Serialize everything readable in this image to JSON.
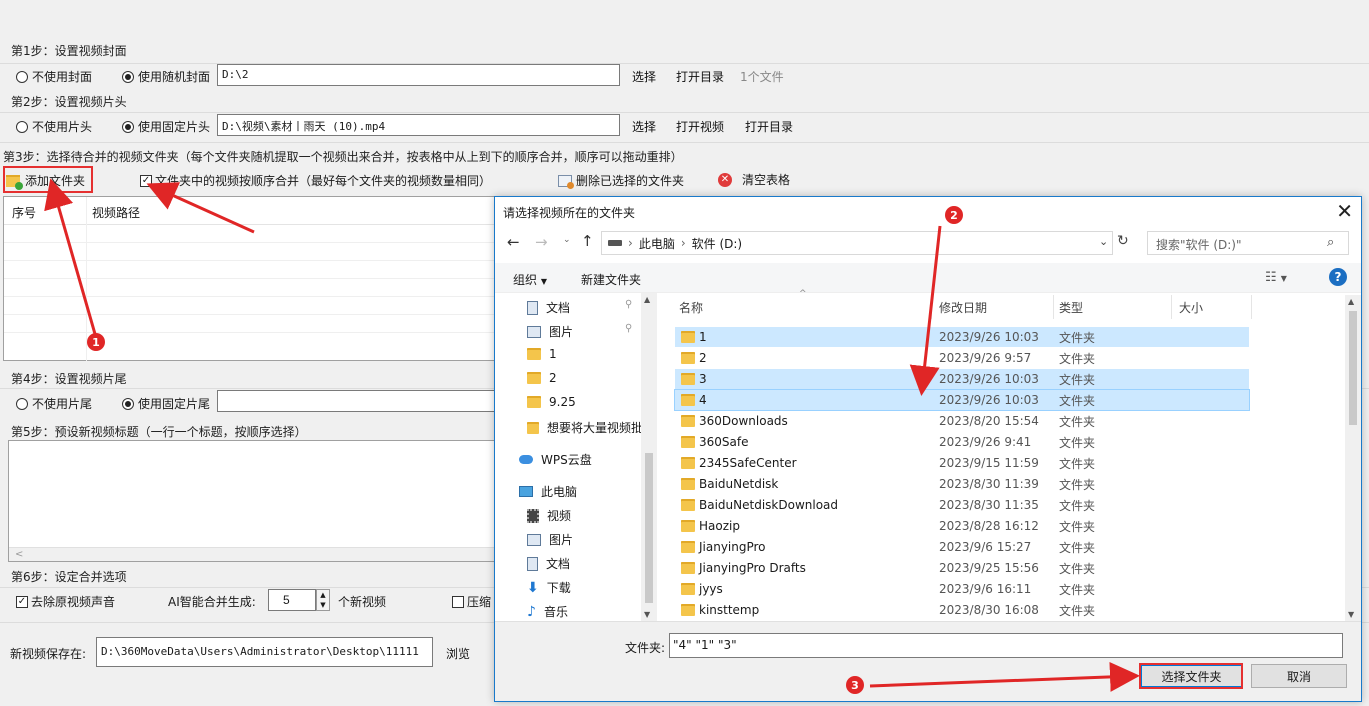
{
  "step1": {
    "title": "第1步：设置视频封面",
    "opt_none": "不使用封面",
    "opt_random": "使用随机封面",
    "path": "D:\\2",
    "select": "选择",
    "open_dir": "打开目录",
    "count": "1个文件"
  },
  "step2": {
    "title": "第2步：设置视频片头",
    "opt_none": "不使用片头",
    "opt_fixed": "使用固定片头",
    "path": "D:\\视频\\素材丨雨天 (10).mp4",
    "select": "选择",
    "open_video": "打开视频",
    "open_dir": "打开目录"
  },
  "step3": {
    "title": "第3步：选择待合并的视频文件夹（每个文件夹随机提取一个视频出来合并，按表格中从上到下的顺序合并，顺序可以拖动重排）",
    "add_folder": "添加文件夹",
    "order_merge": "文件夹中的视频按顺序合并（最好每个文件夹的视频数量相同）",
    "delete_selected": "删除已选择的文件夹",
    "clear_table": "清空表格",
    "col_index": "序号",
    "col_path": "视频路径"
  },
  "step4": {
    "title": "第4步：设置视频片尾",
    "opt_none": "不使用片尾",
    "opt_fixed": "使用固定片尾"
  },
  "step5": {
    "title": "第5步：预设新视频标题（一行一个标题，按顺序选择）"
  },
  "step6": {
    "title": "第6步：设定合并选项",
    "remove_audio": "去除原视频声音",
    "ai_label": "AI智能合并生成:",
    "ai_value": "5",
    "ai_unit": "个新视频",
    "compress": "压缩"
  },
  "save": {
    "label": "新视频保存在:",
    "path": "D:\\360MoveData\\Users\\Administrator\\Desktop\\11111",
    "browse": "浏览"
  },
  "dialog": {
    "title": "请选择视频所在的文件夹",
    "breadcrumb": [
      "此电脑",
      "软件 (D:)"
    ],
    "search_placeholder": "搜索\"软件 (D:)\"",
    "organize": "组织",
    "new_folder": "新建文件夹",
    "nav": [
      {
        "label": "文档",
        "icon": "document-icon",
        "pinned": true
      },
      {
        "label": "图片",
        "icon": "picture-icon",
        "pinned": true
      },
      {
        "label": "1",
        "icon": "folder-icon"
      },
      {
        "label": "2",
        "icon": "folder-icon"
      },
      {
        "label": "9.25",
        "icon": "folder-icon"
      },
      {
        "label": "想要将大量视频批",
        "icon": "folder-icon"
      },
      {
        "label": "WPS云盘",
        "icon": "cloud-icon"
      },
      {
        "label": "此电脑",
        "icon": "computer-icon"
      },
      {
        "label": "视频",
        "icon": "video-icon"
      },
      {
        "label": "图片",
        "icon": "picture-icon"
      },
      {
        "label": "文档",
        "icon": "document-icon"
      },
      {
        "label": "下载",
        "icon": "download-icon"
      },
      {
        "label": "音乐",
        "icon": "music-icon"
      }
    ],
    "columns": {
      "name": "名称",
      "date": "修改日期",
      "type": "类型",
      "size": "大小"
    },
    "files": [
      {
        "name": "1",
        "date": "2023/9/26 10:03",
        "type": "文件夹",
        "selected": true
      },
      {
        "name": "2",
        "date": "2023/9/26 9:57",
        "type": "文件夹",
        "selected": false
      },
      {
        "name": "3",
        "date": "2023/9/26 10:03",
        "type": "文件夹",
        "selected": true
      },
      {
        "name": "4",
        "date": "2023/9/26 10:03",
        "type": "文件夹",
        "selected": true
      },
      {
        "name": "360Downloads",
        "date": "2023/8/20 15:54",
        "type": "文件夹",
        "selected": false
      },
      {
        "name": "360Safe",
        "date": "2023/9/26 9:41",
        "type": "文件夹",
        "selected": false
      },
      {
        "name": "2345SafeCenter",
        "date": "2023/9/15 11:59",
        "type": "文件夹",
        "selected": false
      },
      {
        "name": "BaiduNetdisk",
        "date": "2023/8/30 11:39",
        "type": "文件夹",
        "selected": false
      },
      {
        "name": "BaiduNetdiskDownload",
        "date": "2023/8/30 11:35",
        "type": "文件夹",
        "selected": false
      },
      {
        "name": "Haozip",
        "date": "2023/8/28 16:12",
        "type": "文件夹",
        "selected": false
      },
      {
        "name": "JianyingPro",
        "date": "2023/9/6 15:27",
        "type": "文件夹",
        "selected": false
      },
      {
        "name": "JianyingPro Drafts",
        "date": "2023/9/25 15:56",
        "type": "文件夹",
        "selected": false
      },
      {
        "name": "jyys",
        "date": "2023/9/6 16:11",
        "type": "文件夹",
        "selected": false
      },
      {
        "name": "kinsttemp",
        "date": "2023/8/30 16:08",
        "type": "文件夹",
        "selected": false
      }
    ],
    "folder_label": "文件夹:",
    "folder_value": "\"4\" \"1\" \"3\"",
    "select_button": "选择文件夹",
    "cancel_button": "取消"
  },
  "annotations": [
    "1",
    "2",
    "3"
  ],
  "colors": {
    "accent": "#1979ca",
    "highlight": "#e02626",
    "selection": "#cce8ff"
  }
}
